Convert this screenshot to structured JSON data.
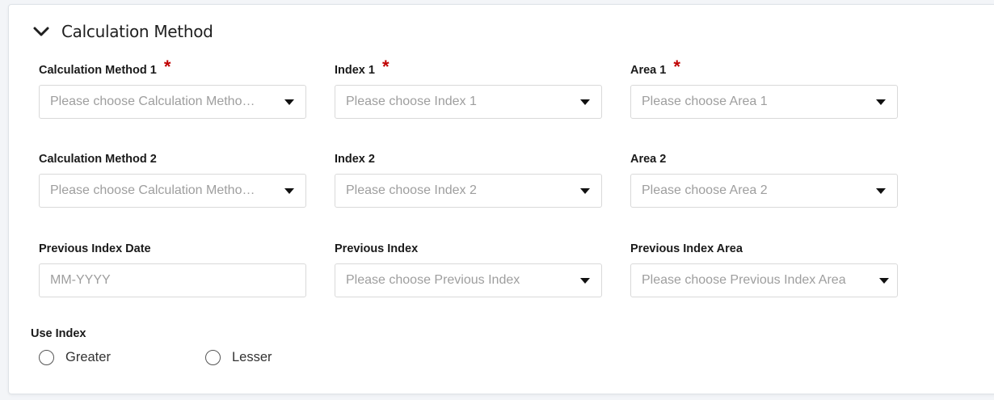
{
  "section": {
    "title": "Calculation Method",
    "icon": "chevron-down-icon"
  },
  "fields": {
    "calc_method_1": {
      "label": "Calculation Method 1",
      "required": true,
      "placeholder": "Please choose Calculation Metho…"
    },
    "index_1": {
      "label": "Index 1",
      "required": true,
      "placeholder": "Please choose Index 1"
    },
    "area_1": {
      "label": "Area 1",
      "required": true,
      "placeholder": "Please choose Area 1"
    },
    "calc_method_2": {
      "label": "Calculation Method 2",
      "placeholder": "Please choose Calculation Metho…"
    },
    "index_2": {
      "label": "Index 2",
      "placeholder": "Please choose Index 2"
    },
    "area_2": {
      "label": "Area 2",
      "placeholder": "Please choose Area 2"
    },
    "prev_index_date": {
      "label": "Previous Index Date",
      "placeholder": "MM-YYYY"
    },
    "prev_index": {
      "label": "Previous Index",
      "placeholder": "Please choose Previous Index"
    },
    "prev_index_area": {
      "label": "Previous Index Area",
      "placeholder": "Please choose Previous Index Area"
    }
  },
  "required_marker": "*",
  "use_index": {
    "label": "Use Index",
    "options": [
      {
        "label": "Greater",
        "selected": false
      },
      {
        "label": "Lesser",
        "selected": false
      }
    ]
  },
  "colors": {
    "required": "#c00000",
    "placeholder": "#9e9e9e",
    "border": "#d9d9d9"
  }
}
